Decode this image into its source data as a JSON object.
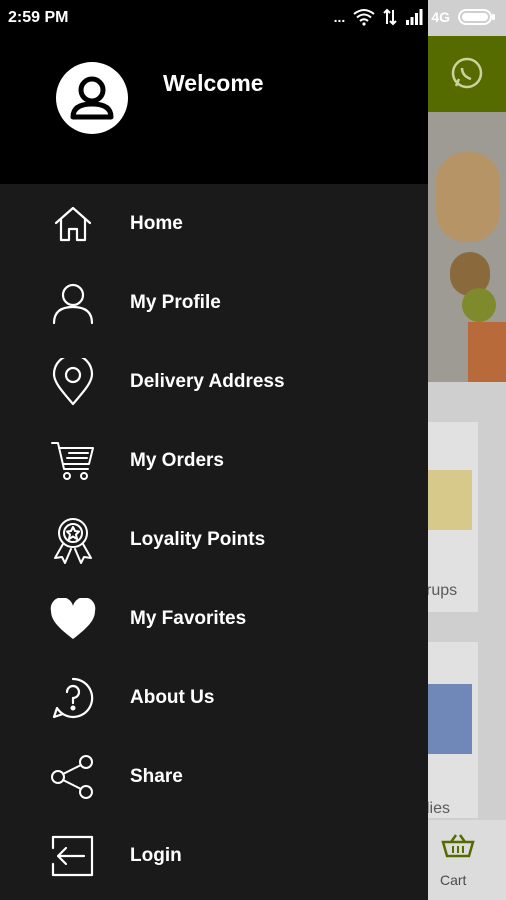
{
  "status_bar": {
    "time": "2:59 PM",
    "network": "4G",
    "more": "..."
  },
  "drawer": {
    "welcome": "Welcome",
    "items": [
      {
        "label": "Home",
        "icon": "home-icon"
      },
      {
        "label": "My Profile",
        "icon": "user-icon"
      },
      {
        "label": "Delivery Address",
        "icon": "location-pin-icon"
      },
      {
        "label": "My Orders",
        "icon": "cart-icon"
      },
      {
        "label": "Loyality Points",
        "icon": "badge-icon"
      },
      {
        "label": "My Favorites",
        "icon": "heart-icon"
      },
      {
        "label": "About Us",
        "icon": "question-icon"
      },
      {
        "label": "Share",
        "icon": "share-icon"
      },
      {
        "label": "Login",
        "icon": "login-icon"
      }
    ]
  },
  "background_app": {
    "partial_text_1": "rups",
    "partial_text_2": "lies",
    "cart_label": "Cart",
    "accent_color": "#556b00"
  }
}
